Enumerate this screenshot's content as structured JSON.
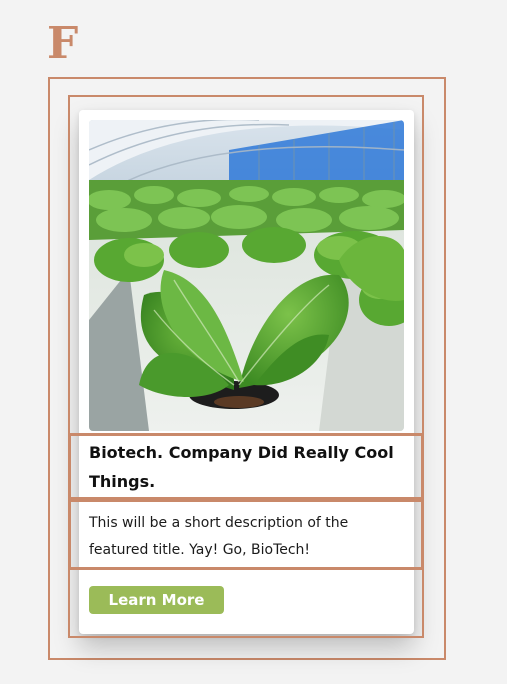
{
  "logo": {
    "letter": "F"
  },
  "card": {
    "image_alt": "Seedlings growing in a greenhouse",
    "title": "Biotech. Company Did Really Cool Things.",
    "description": "This will be a short description of the featured title. Yay! Go, BioTech!",
    "button_label": "Learn More"
  },
  "colors": {
    "accent": "#c9896a",
    "button": "#9bbb58",
    "background": "#f3f3f3",
    "card": "#ffffff"
  }
}
